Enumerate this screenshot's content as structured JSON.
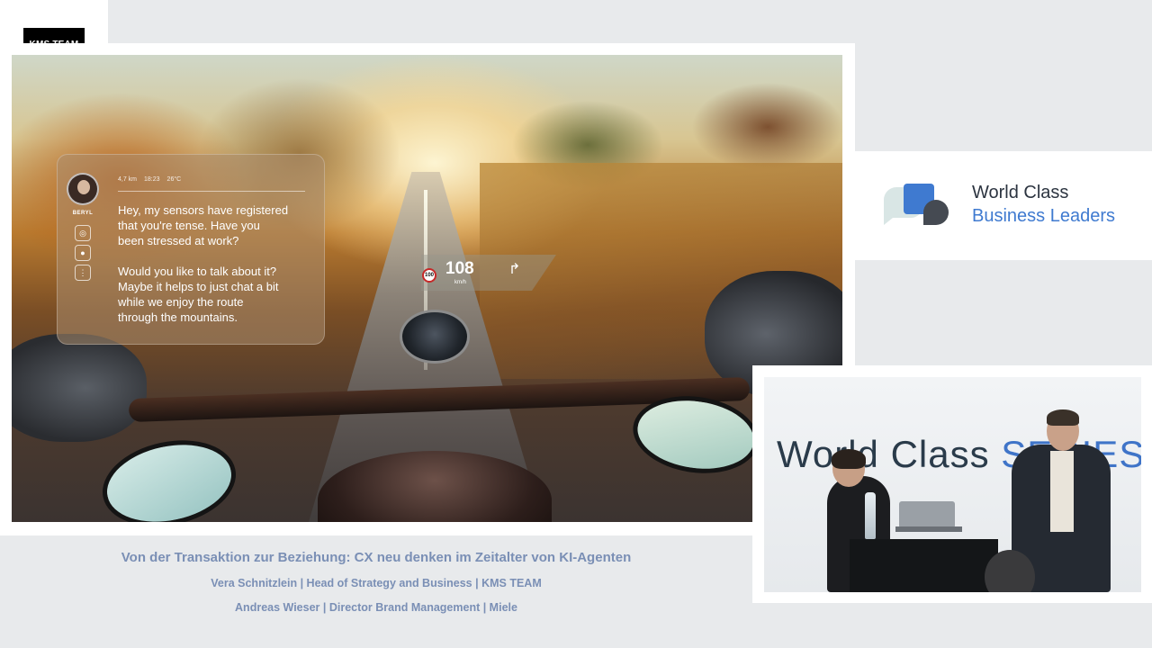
{
  "logo": {
    "label": "KMS TEAM"
  },
  "slide": {
    "hud": {
      "avatar_name": "BERYL",
      "status": {
        "distance": "4,7 km",
        "time": "18:23",
        "temperature": "26°C"
      },
      "message_1": "Hey, my sensors have registered\nthat you're tense. Have you\nbeen stressed at work?",
      "message_2": "Would you like to talk about it?\nMaybe it helps to just chat a bit\nwhile we enjoy the route\nthrough the mountains.",
      "icons": [
        "focus-icon",
        "brain-icon",
        "equalizer-icon"
      ]
    },
    "speed": {
      "limit": "100",
      "value": "108",
      "unit": "km/h",
      "turn_icon": "turn-right-icon"
    }
  },
  "brand_panel": {
    "line1": "World Class",
    "line2": "Business Leaders",
    "accent": "#3f7ad0"
  },
  "video": {
    "backdrop_text_main": "World Class ",
    "backdrop_text_accent": "SERIES"
  },
  "caption": {
    "title": "Von der Transaktion zur Beziehung: CX neu denken im Zeitalter von KI-Agenten",
    "speaker_1": "Vera Schnitzlein | Head of Strategy and Business | KMS TEAM",
    "speaker_2": "Andreas Wieser | Director Brand Management | Miele"
  },
  "colors": {
    "background": "#e8eaec",
    "caption": "#7a8fb5"
  }
}
